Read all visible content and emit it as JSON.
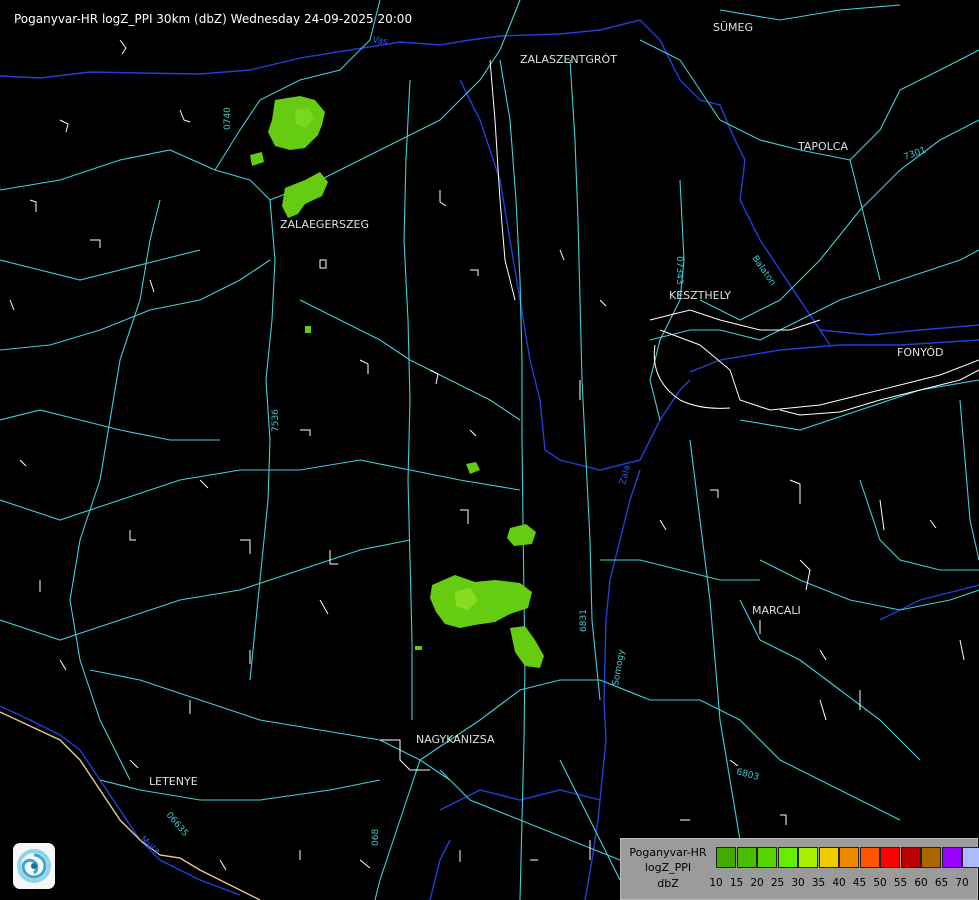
{
  "header": {
    "title": "Poganyvar-HR logZ_PPI 30km (dbZ) Wednesday 24-09-2025 20:00"
  },
  "cities": {
    "sumeg": "SÜMEG",
    "zalaszentgrot": "ZALASZENTGRÓT",
    "tapolca": "TAPOLCA",
    "zalaegerszeg": "ZALAEGERSZEG",
    "keszthely": "KESZTHELY",
    "fonyod": "FONYÓD",
    "marcali": "MARCALI",
    "nagykanizsa": "NAGYKANIZSA",
    "letenye": "LETENYE"
  },
  "road_labels": {
    "r0740": "0740",
    "r07343": "07343",
    "r7301": "7301",
    "r7536": "7536",
    "r6831": "6831",
    "r6803": "6803",
    "r06635": "06635",
    "r68l": "068",
    "r_balaton": "Balaton",
    "r_somogy": "Somogy"
  },
  "river_labels": {
    "zala": "Zala",
    "vas": "Vas",
    "mura": "Mura"
  },
  "legend": {
    "title_lines": [
      "Poganyvar-HR",
      "logZ_PPI",
      "dbZ"
    ],
    "ticks": [
      "10",
      "15",
      "20",
      "25",
      "30",
      "35",
      "40",
      "45",
      "50",
      "55",
      "60",
      "65",
      "70"
    ],
    "colors": [
      "#44aa00",
      "#4cbe00",
      "#55d400",
      "#66ee00",
      "#aaee00",
      "#eecc00",
      "#ee8800",
      "#ff5500",
      "#ff0000",
      "#bb0000",
      "#aa6600",
      "#9900ff",
      "#aabbff"
    ]
  },
  "colors": {
    "road": "#3fd0d8",
    "river": "#2040d8",
    "border": "#e8c890",
    "echo_light": "#66cc11",
    "echo_strong": "#88dd22"
  },
  "logo": {
    "icon": "logo-swirl-icon"
  }
}
